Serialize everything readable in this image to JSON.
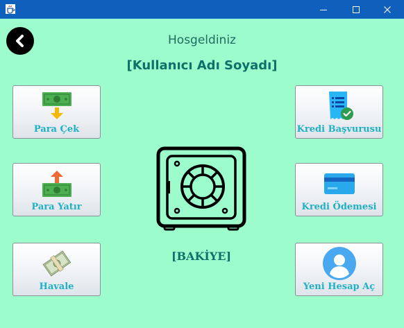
{
  "window": {
    "icons": {
      "app": "java-cup-icon",
      "minimize": "minimize-icon",
      "maximize": "maximize-icon",
      "close": "close-icon"
    }
  },
  "header": {
    "back_icon": "back-arrow-icon",
    "welcome": "Hosgeldiniz",
    "user_name": "[Kullanıcı Adı Soyadı]"
  },
  "actions": {
    "withdraw": {
      "label": "Para Çek",
      "icon": "money-withdraw-icon"
    },
    "deposit": {
      "label": "Para Yatır",
      "icon": "money-deposit-icon"
    },
    "transfer": {
      "label": "Havale",
      "icon": "money-bundle-icon"
    },
    "loan_application": {
      "label": "Kredi Başvurusu",
      "icon": "document-check-icon"
    },
    "loan_payment": {
      "label": "Kredi Ödemesi",
      "icon": "credit-card-icon"
    },
    "new_account": {
      "label": "Yeni Hesap Aç",
      "icon": "user-avatar-icon"
    }
  },
  "balance": {
    "icon": "safe-icon",
    "label": "[BAKİYE]"
  },
  "colors": {
    "background": "#9dfccb",
    "titlebar": "#0f5fbd",
    "button_label": "#20b0c4",
    "heading": "#0f6f6a"
  }
}
